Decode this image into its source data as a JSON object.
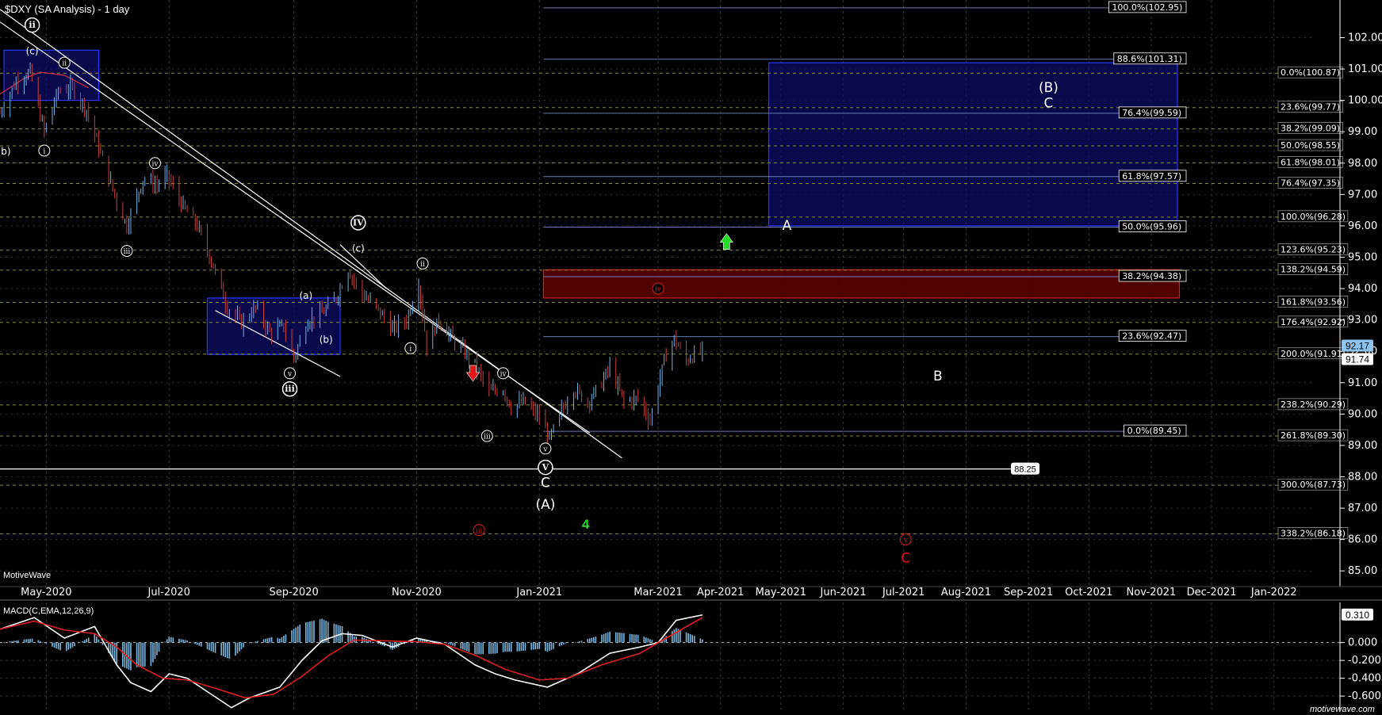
{
  "header": {
    "title": "$DXY (SA Analysis) - 1 day"
  },
  "watermark": "MotiveWave",
  "footer_brand": "motivewave.com",
  "colors": {
    "background": "#000000",
    "up_bar": "#6fb4e6",
    "down_bar": "#c94040",
    "fib_box_fill": "#0c0c66",
    "fib_box_stroke": "#2a38ff",
    "red_box_fill": "#5a0000",
    "red_box_stroke": "#d42020",
    "green": "#22dd22",
    "red": "#e01818"
  },
  "chart_data": [
    {
      "type": "candlestick",
      "title": "$DXY (SA Analysis) - 1 day",
      "x_axis": {
        "type": "date",
        "range": [
          "2020-04-08",
          "2022-01-20"
        ],
        "tick_labels": [
          "May-2020",
          "Jul-2020",
          "Sep-2020",
          "Nov-2020",
          "Jan-2021",
          "Mar-2021",
          "Apr-2021",
          "May-2021",
          "Jun-2021",
          "Jul-2021",
          "Aug-2021",
          "Sep-2021",
          "Oct-2021",
          "Nov-2021",
          "Dec-2021",
          "Jan-2022"
        ],
        "tick_dates": [
          "2020-05-01",
          "2020-07-01",
          "2020-09-01",
          "2020-11-01",
          "2021-01-01",
          "2021-03-01",
          "2021-04-01",
          "2021-05-01",
          "2021-06-01",
          "2021-07-01",
          "2021-08-01",
          "2021-09-01",
          "2021-10-01",
          "2021-11-01",
          "2021-12-01",
          "2022-01-01"
        ]
      },
      "y_axis": {
        "range": [
          84.5,
          103.2
        ],
        "tick_labels": [
          "85.00",
          "86.00",
          "87.00",
          "88.00",
          "89.00",
          "90.00",
          "91.00",
          "92.00",
          "93.00",
          "94.00",
          "95.00",
          "96.00",
          "97.00",
          "98.00",
          "99.00",
          "100.00",
          "101.00",
          "102.00"
        ],
        "position": "right"
      },
      "price_path": [
        [
          "2020-04-08",
          99.6
        ],
        [
          "2020-04-16",
          100.6
        ],
        [
          "2020-04-23",
          100.9
        ],
        [
          "2020-04-30",
          99.0
        ],
        [
          "2020-05-07",
          100.3
        ],
        [
          "2020-05-14",
          100.4
        ],
        [
          "2020-05-21",
          99.7
        ],
        [
          "2020-05-28",
          98.3
        ],
        [
          "2020-06-05",
          96.8
        ],
        [
          "2020-06-10",
          96.0
        ],
        [
          "2020-06-18",
          97.5
        ],
        [
          "2020-06-25",
          97.3
        ],
        [
          "2020-06-30",
          97.6
        ],
        [
          "2020-07-08",
          96.6
        ],
        [
          "2020-07-15",
          96.0
        ],
        [
          "2020-07-22",
          94.9
        ],
        [
          "2020-07-30",
          93.4
        ],
        [
          "2020-08-06",
          92.9
        ],
        [
          "2020-08-13",
          93.4
        ],
        [
          "2020-08-20",
          92.6
        ],
        [
          "2020-08-27",
          92.8
        ],
        [
          "2020-09-01",
          91.8
        ],
        [
          "2020-09-08",
          93.0
        ],
        [
          "2020-09-15",
          93.2
        ],
        [
          "2020-09-22",
          93.7
        ],
        [
          "2020-09-28",
          94.6
        ],
        [
          "2020-10-05",
          93.8
        ],
        [
          "2020-10-12",
          93.4
        ],
        [
          "2020-10-20",
          92.7
        ],
        [
          "2020-10-27",
          93.0
        ],
        [
          "2020-11-02",
          94.2
        ],
        [
          "2020-11-06",
          92.2
        ],
        [
          "2020-11-12",
          93.0
        ],
        [
          "2020-11-20",
          92.3
        ],
        [
          "2020-11-30",
          91.6
        ],
        [
          "2020-12-07",
          90.7
        ],
        [
          "2020-12-14",
          90.8
        ],
        [
          "2020-12-18",
          90.2
        ],
        [
          "2020-12-24",
          90.4
        ],
        [
          "2021-01-01",
          89.9
        ],
        [
          "2021-01-06",
          89.2
        ],
        [
          "2021-01-12",
          90.1
        ],
        [
          "2021-01-18",
          90.8
        ],
        [
          "2021-01-25",
          90.4
        ],
        [
          "2021-02-01",
          91.0
        ],
        [
          "2021-02-05",
          91.5
        ],
        [
          "2021-02-12",
          90.4
        ],
        [
          "2021-02-19",
          90.5
        ],
        [
          "2021-02-25",
          89.8
        ],
        [
          "2021-03-04",
          91.7
        ],
        [
          "2021-03-09",
          92.4
        ],
        [
          "2021-03-15",
          91.7
        ],
        [
          "2021-03-19",
          91.9
        ],
        [
          "2021-03-23",
          92.0
        ]
      ],
      "last_price": "91.74",
      "last_price_alt": "92.17",
      "horizontal_line": {
        "value": 88.25,
        "label": "88.25"
      },
      "fib_labels_axis_column": [
        {
          "text": "0.0%(100.87)",
          "value": 100.87
        },
        {
          "text": "23.6%(99.77)",
          "value": 99.77
        },
        {
          "text": "38.2%(99.09)",
          "value": 99.09
        },
        {
          "text": "50.0%(98.55)",
          "value": 98.55
        },
        {
          "text": "61.8%(98.01)",
          "value": 98.01
        },
        {
          "text": "76.4%(97.35)",
          "value": 97.35
        },
        {
          "text": "100.0%(96.28)",
          "value": 96.28
        },
        {
          "text": "123.6%(95.23)",
          "value": 95.23
        },
        {
          "text": "138.2%(94.59)",
          "value": 94.59
        },
        {
          "text": "161.8%(93.56)",
          "value": 93.56
        },
        {
          "text": "176.4%(92.92)",
          "value": 92.92
        },
        {
          "text": "200.0%(91.91)",
          "value": 91.91
        },
        {
          "text": "238.2%(90.29)",
          "value": 90.29
        },
        {
          "text": "261.8%(89.30)",
          "value": 89.3
        },
        {
          "text": "300.0%(87.73)",
          "value": 87.73
        },
        {
          "text": "338.2%(86.18)",
          "value": 86.18
        }
      ],
      "fib_labels_grey": [
        {
          "text": "100.0%(102.95)",
          "value": 102.95
        },
        {
          "text": "88.6%(101.31)",
          "value": 101.31
        },
        {
          "text": "76.4%(99.59)",
          "value": 99.59
        },
        {
          "text": "61.8%(97.57)",
          "value": 97.57
        },
        {
          "text": "50.0%(95.96)",
          "value": 95.96
        },
        {
          "text": "38.2%(94.38)",
          "value": 94.38
        },
        {
          "text": "23.6%(92.47)",
          "value": 92.47
        },
        {
          "text": "0.0%(89.45)",
          "value": 89.45
        }
      ],
      "zones": [
        {
          "name": "blue-target-box",
          "from": "2021-04-25",
          "to": "2021-11-14",
          "low": 96.0,
          "high": 101.2,
          "color": "blue"
        },
        {
          "name": "red-iv-box",
          "from": "2021-01-03",
          "to": "2021-11-15",
          "low": 93.7,
          "high": 94.6,
          "color": "red"
        },
        {
          "name": "blue-box-2020-04",
          "from": "2020-04-10",
          "to": "2020-05-27",
          "low": 100.0,
          "high": 101.6,
          "color": "blue"
        },
        {
          "name": "blue-box-2020-08",
          "from": "2020-07-20",
          "to": "2020-09-24",
          "low": 91.9,
          "high": 93.7,
          "color": "blue"
        }
      ],
      "wave_labels": [
        {
          "text": "ii",
          "date": "2020-04-24",
          "value": 102.4,
          "style": "circled-bold"
        },
        {
          "text": "(c)",
          "date": "2020-04-24",
          "value": 101.6,
          "style": "plain"
        },
        {
          "text": "ii",
          "date": "2020-05-10",
          "value": 101.2,
          "style": "circled"
        },
        {
          "text": "(b)",
          "date": "2020-04-10",
          "value": 98.4,
          "style": "plain"
        },
        {
          "text": "i",
          "date": "2020-04-30",
          "value": 98.4,
          "style": "circled"
        },
        {
          "text": "iv",
          "date": "2020-06-24",
          "value": 98.0,
          "style": "circled"
        },
        {
          "text": "iii",
          "date": "2020-06-10",
          "value": 95.2,
          "style": "circled"
        },
        {
          "text": "IV",
          "date": "2020-10-03",
          "value": 96.1,
          "style": "circled-bold"
        },
        {
          "text": "(c)",
          "date": "2020-10-03",
          "value": 95.3,
          "style": "plain"
        },
        {
          "text": "(a)",
          "date": "2020-09-07",
          "value": 93.8,
          "style": "plain"
        },
        {
          "text": "(b)",
          "date": "2020-09-17",
          "value": 92.4,
          "style": "plain"
        },
        {
          "text": "v",
          "date": "2020-08-30",
          "value": 91.3,
          "style": "circled"
        },
        {
          "text": "iii",
          "date": "2020-08-30",
          "value": 90.8,
          "style": "circled-bold"
        },
        {
          "text": "ii",
          "date": "2020-11-04",
          "value": 94.8,
          "style": "circled"
        },
        {
          "text": "i",
          "date": "2020-10-29",
          "value": 92.1,
          "style": "circled"
        },
        {
          "text": "iv",
          "date": "2020-12-14",
          "value": 91.3,
          "style": "circled"
        },
        {
          "text": "iii",
          "date": "2020-12-06",
          "value": 89.3,
          "style": "circled"
        },
        {
          "text": "v",
          "date": "2021-01-04",
          "value": 88.9,
          "style": "circled"
        },
        {
          "text": "V",
          "date": "2021-01-04",
          "value": 88.3,
          "style": "circled-bold"
        },
        {
          "text": "C",
          "date": "2021-01-04",
          "value": 87.8,
          "style": "plain-large"
        },
        {
          "text": "(A)",
          "date": "2021-01-04",
          "value": 87.1,
          "style": "plain-large"
        },
        {
          "text": "A",
          "date": "2021-05-04",
          "value": 96.0,
          "style": "plain-large"
        },
        {
          "text": "(B)",
          "date": "2021-09-11",
          "value": 100.4,
          "style": "plain-large"
        },
        {
          "text": "C",
          "date": "2021-09-11",
          "value": 99.9,
          "style": "plain-large"
        },
        {
          "text": "B",
          "date": "2021-07-18",
          "value": 91.2,
          "style": "plain-large"
        }
      ],
      "red_labels": [
        {
          "text": "iii",
          "date": "2020-12-02",
          "value": 86.3,
          "style": "circled-red"
        },
        {
          "text": "iv",
          "date": "2021-03-01",
          "value": 94.0,
          "style": "circled-red"
        },
        {
          "text": "v",
          "date": "2021-07-02",
          "value": 86.0,
          "style": "circled-red"
        },
        {
          "text": "C",
          "date": "2021-07-02",
          "value": 85.4,
          "style": "plain-red"
        }
      ],
      "green_labels": [
        {
          "text": "4",
          "date": "2021-01-24",
          "value": 86.5
        }
      ],
      "arrows": [
        {
          "direction": "down",
          "color": "red",
          "date": "2020-11-29",
          "value": 91.3
        },
        {
          "direction": "up",
          "color": "green",
          "date": "2021-04-04",
          "value": 95.5
        }
      ]
    },
    {
      "type": "line",
      "title": "MACD(C,EMA,12,26,9)",
      "y_axis": {
        "range": [
          -0.75,
          0.45
        ],
        "tick_labels": [
          "0.000",
          "-0.200",
          "-0.400",
          "-0.600"
        ]
      },
      "current_value": "0.310",
      "series": [
        {
          "name": "MACD",
          "color": "white",
          "points": [
            [
              "2020-04-08",
              0.15
            ],
            [
              "2020-04-25",
              0.28
            ],
            [
              "2020-05-10",
              0.05
            ],
            [
              "2020-05-25",
              0.18
            ],
            [
              "2020-06-05",
              -0.25
            ],
            [
              "2020-06-12",
              -0.45
            ],
            [
              "2020-06-22",
              -0.55
            ],
            [
              "2020-07-01",
              -0.35
            ],
            [
              "2020-07-10",
              -0.4
            ],
            [
              "2020-07-22",
              -0.58
            ],
            [
              "2020-08-01",
              -0.73
            ],
            [
              "2020-08-10",
              -0.62
            ],
            [
              "2020-08-25",
              -0.5
            ],
            [
              "2020-09-05",
              -0.2
            ],
            [
              "2020-09-15",
              0.02
            ],
            [
              "2020-09-25",
              0.1
            ],
            [
              "2020-10-05",
              0.08
            ],
            [
              "2020-10-20",
              -0.05
            ],
            [
              "2020-11-01",
              0.05
            ],
            [
              "2020-11-15",
              -0.02
            ],
            [
              "2020-11-30",
              -0.25
            ],
            [
              "2020-12-10",
              -0.35
            ],
            [
              "2020-12-20",
              -0.42
            ],
            [
              "2021-01-05",
              -0.5
            ],
            [
              "2021-01-20",
              -0.35
            ],
            [
              "2021-02-05",
              -0.12
            ],
            [
              "2021-02-20",
              -0.05
            ],
            [
              "2021-03-01",
              0.0
            ],
            [
              "2021-03-10",
              0.25
            ],
            [
              "2021-03-23",
              0.31
            ]
          ]
        },
        {
          "name": "Signal",
          "color": "red",
          "points": [
            [
              "2020-04-08",
              0.15
            ],
            [
              "2020-04-25",
              0.24
            ],
            [
              "2020-05-10",
              0.14
            ],
            [
              "2020-05-25",
              0.1
            ],
            [
              "2020-06-05",
              -0.05
            ],
            [
              "2020-06-15",
              -0.25
            ],
            [
              "2020-06-28",
              -0.4
            ],
            [
              "2020-07-10",
              -0.42
            ],
            [
              "2020-07-25",
              -0.52
            ],
            [
              "2020-08-08",
              -0.62
            ],
            [
              "2020-08-22",
              -0.58
            ],
            [
              "2020-09-05",
              -0.38
            ],
            [
              "2020-09-18",
              -0.15
            ],
            [
              "2020-10-01",
              0.03
            ],
            [
              "2020-10-15",
              0.02
            ],
            [
              "2020-11-01",
              0.01
            ],
            [
              "2020-11-15",
              -0.02
            ],
            [
              "2020-12-01",
              -0.15
            ],
            [
              "2020-12-15",
              -0.3
            ],
            [
              "2021-01-01",
              -0.42
            ],
            [
              "2021-01-15",
              -0.4
            ],
            [
              "2021-02-01",
              -0.25
            ],
            [
              "2021-02-20",
              -0.12
            ],
            [
              "2021-03-05",
              0.05
            ],
            [
              "2021-03-23",
              0.28
            ]
          ]
        }
      ]
    }
  ]
}
